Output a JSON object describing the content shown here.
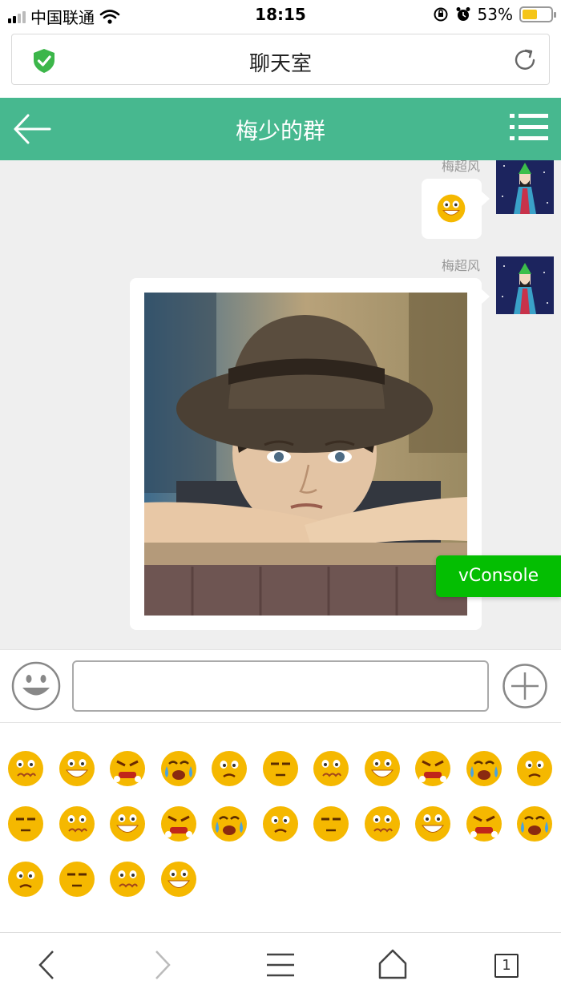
{
  "status": {
    "carrier": "中国联通",
    "time": "18:15",
    "battery": "53%",
    "battery_level": 0.53
  },
  "browser": {
    "page_title": "聊天室"
  },
  "header": {
    "title": "梅少的群"
  },
  "messages": [
    {
      "sender": "梅超风",
      "type": "emoji"
    },
    {
      "sender": "梅超风",
      "type": "image"
    }
  ],
  "vconsole": {
    "label": "vConsole"
  },
  "input": {
    "value": "",
    "placeholder": ""
  },
  "emojis": [
    "worried-emoji-icon",
    "laughing-emoji-icon",
    "angry-emoji-icon",
    "crying-laughing-emoji-icon",
    "confused-emoji-icon",
    "smirk-emoji-icon",
    "pouting-emoji-icon",
    "blank-emoji-icon",
    "dizzy-emoji-icon",
    "puzzled-emoji-icon",
    "dead-emoji-icon",
    "heart-eyes-emoji-icon",
    "grinning-emoji-icon",
    "shy-emoji-icon",
    "sweat-emoji-icon",
    "sad-emoji-icon",
    "snot-emoji-icon",
    "kiss-emoji-icon",
    "sleepy-emoji-icon",
    "meh-emoji-icon",
    "shout-emoji-icon",
    "cool-emoji-icon",
    "scared-emoji-icon",
    "blissful-emoji-icon",
    "sobbing-emoji-icon",
    "wink-emoji-icon"
  ],
  "bottom_nav": {
    "tab_count": "1"
  },
  "colors": {
    "header": "#47b88f",
    "vconsole": "#04be02",
    "emoji": "#f5b800",
    "chat_bg": "#efefef"
  }
}
